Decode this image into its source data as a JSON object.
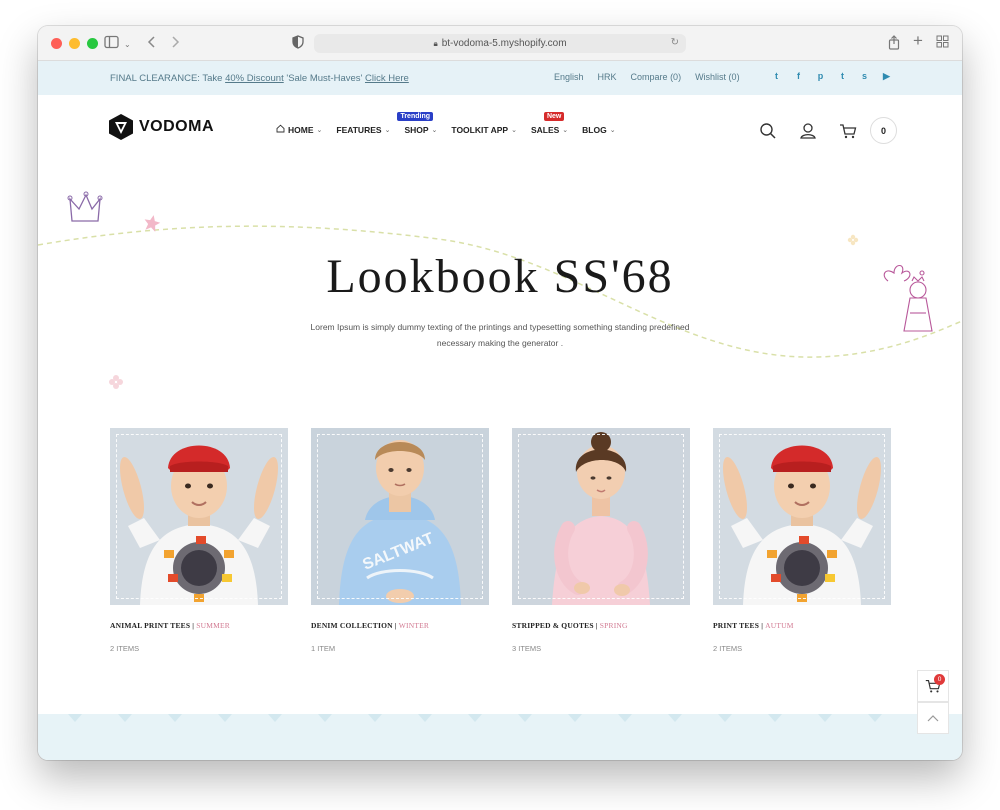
{
  "browser": {
    "url": "bt-vodoma-5.myshopify.com"
  },
  "topbar": {
    "promo_prefix": "FINAL CLEARANCE: Take ",
    "promo_link": "40% Discount",
    "promo_middle": " 'Sale Must-Haves' ",
    "promo_cta": "Click Here",
    "language": "English",
    "currency": "HRK",
    "compare": "Compare (0)",
    "wishlist": "Wishlist (0)",
    "social_icons": [
      "twitter-icon",
      "facebook-icon",
      "pinterest-icon",
      "tumblr-icon",
      "snapchat-icon",
      "youtube-icon"
    ],
    "social_glyphs": [
      "t",
      "f",
      "p",
      "t",
      "s",
      "▶"
    ]
  },
  "header": {
    "logo": "VODOMA",
    "nav": [
      {
        "label": "HOME",
        "badge": ""
      },
      {
        "label": "FEATURES",
        "badge": ""
      },
      {
        "label": "SHOP",
        "badge": "Trending",
        "badge_color": "#2a3fc7"
      },
      {
        "label": "TOOLKIT APP",
        "badge": ""
      },
      {
        "label": "SALES",
        "badge": "New",
        "badge_color": "#d62b2b"
      },
      {
        "label": "BLOG",
        "badge": ""
      }
    ],
    "cart_count": "0"
  },
  "hero": {
    "title": "Lookbook SS'68",
    "description": "Lorem Ipsum is simply dummy texting of the printings and typesetting something standing predefined necessary making the generator ."
  },
  "lookbook": [
    {
      "name": "ANIMAL PRINT TEES",
      "season": "SUMMER",
      "count": "2 ITEMS"
    },
    {
      "name": "DENIM COLLECTION",
      "season": "WINTER",
      "count": "1 ITEM"
    },
    {
      "name": "STRIPPED & QUOTES",
      "season": "SPRING",
      "count": "3 ITEMS"
    },
    {
      "name": "PRINT TEES",
      "season": "AUTUM",
      "count": "2 ITEMS"
    }
  ],
  "floating": {
    "cart_badge": "0"
  },
  "colors": {
    "accent_blue": "#2f8bb0",
    "topbar_bg": "#e6f2f7",
    "season_pink": "#d27b93"
  }
}
